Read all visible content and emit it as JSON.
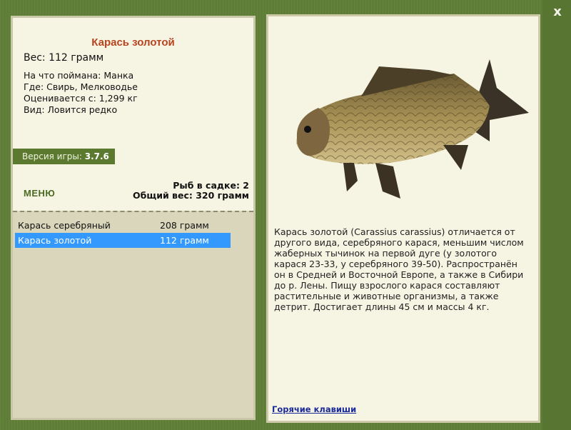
{
  "window": {
    "close_label": "x"
  },
  "catch_info": {
    "title": "Карась золотой",
    "weight": "Вес: 112 грамм",
    "bait": "На что поймана: Манка",
    "location": "Где: Свирь, Мелководье",
    "value": "Оценивается с: 1,299 кг",
    "rarity": "Вид: Ловится редко"
  },
  "version": {
    "label": "Версия игры:",
    "value": "3.7.6"
  },
  "menu": {
    "label": "МЕНЮ"
  },
  "keepnet": {
    "count": "Рыб в садке: 2",
    "total": "Общий вес: 320 грамм"
  },
  "fish_list": [
    {
      "name": "Карась серебряный",
      "weight": "208 грамм",
      "selected": false
    },
    {
      "name": "Карась золотой",
      "weight": "112 грамм",
      "selected": true
    }
  ],
  "description": "Карась золотой (Carassius carassius) отличается от другого вида, серебряного карася, меньшим числом жаберных тычинок на первой дуге (у золотого карася 23-33, у серебряного 39-50). Распространён он в Средней и Восточной Европе, а также в Сибири до р. Лены. Пищу взрослого карася составляют растительные и животные организмы, а также детрит. Достигает длины 45 см и массы 4 кг.",
  "hotkeys": {
    "label": "Горячие клавиши"
  },
  "colors": {
    "frame": "#5e7d36",
    "panel": "#f6f4e3",
    "title": "#b6441f",
    "selected": "#3399ff"
  }
}
